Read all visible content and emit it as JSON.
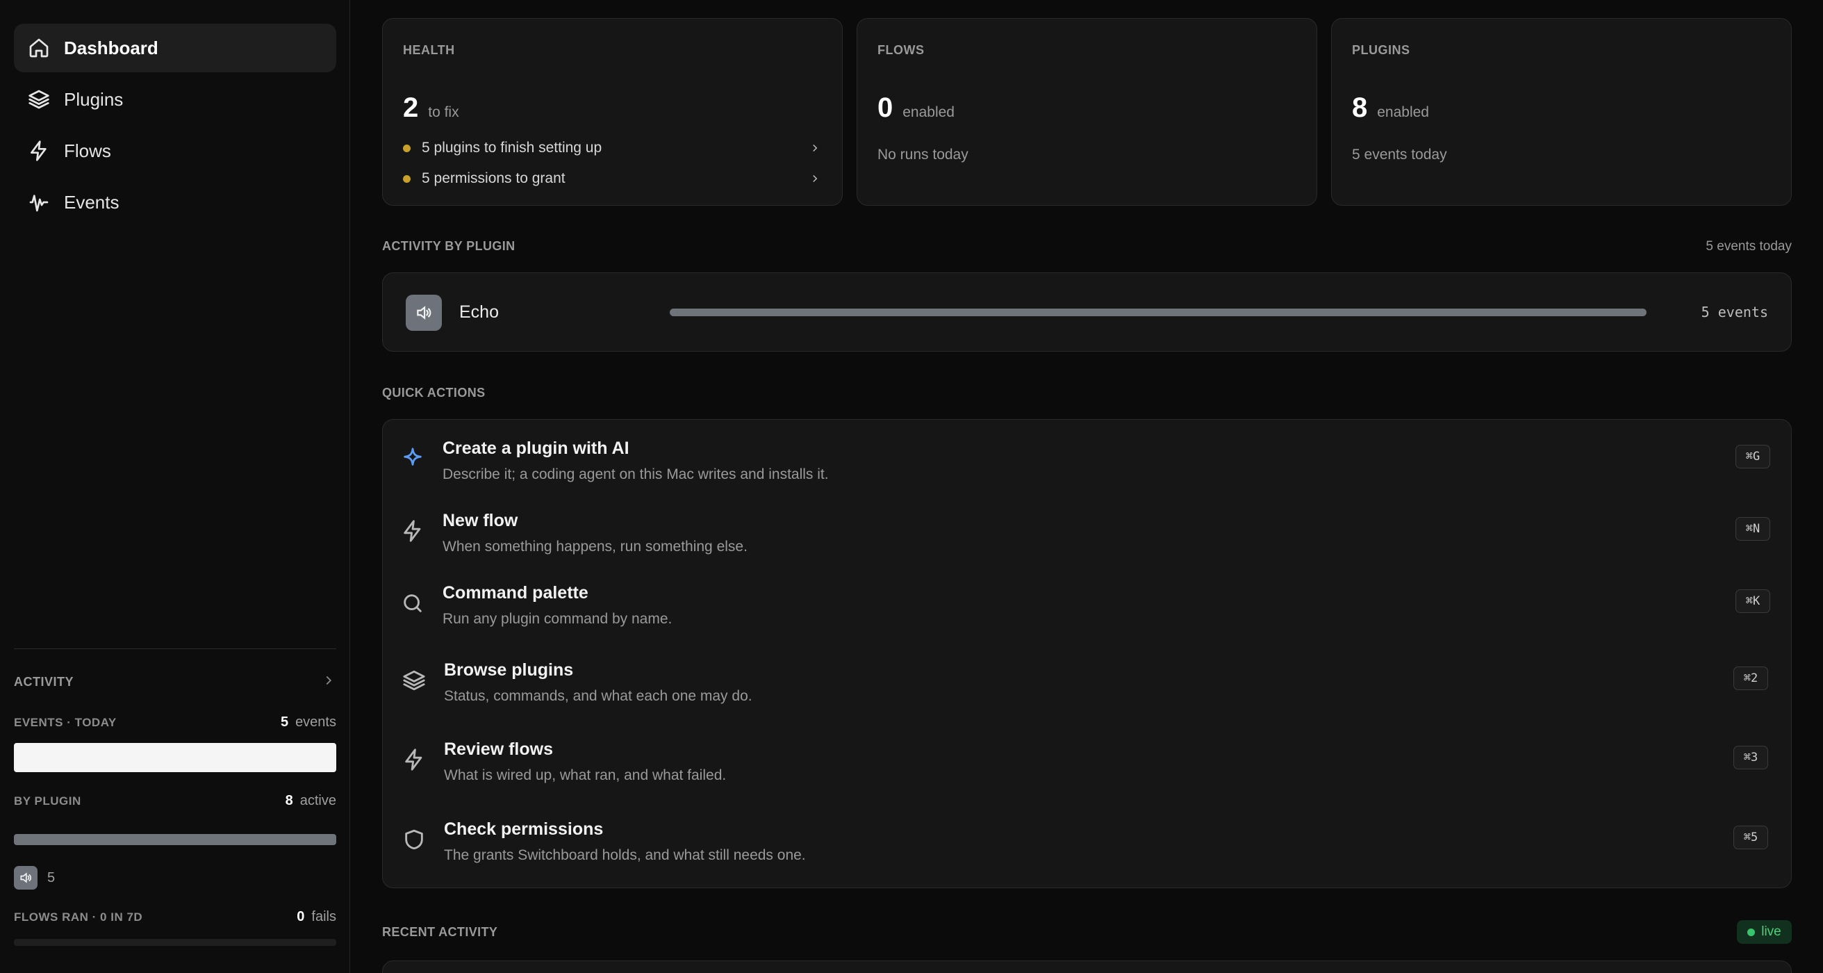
{
  "sidebar": {
    "nav": [
      {
        "label": "Dashboard",
        "icon": "home-icon",
        "active": true
      },
      {
        "label": "Plugins",
        "icon": "layers-icon",
        "active": false
      },
      {
        "label": "Flows",
        "icon": "bolt-icon",
        "active": false
      },
      {
        "label": "Events",
        "icon": "waveform-icon",
        "active": false
      }
    ],
    "activity": {
      "title": "ACTIVITY",
      "events_label": "EVENTS · TODAY",
      "events_count": "5",
      "events_unit": "events",
      "by_plugin_label": "BY PLUGIN",
      "by_plugin_count": "8",
      "by_plugin_unit": "active",
      "plugin_count": "5",
      "flows_label": "FLOWS RAN · 0 IN 7D",
      "flows_count": "0",
      "flows_unit": "fails"
    }
  },
  "cards": {
    "health": {
      "label": "HEALTH",
      "value": "2",
      "unit": "to fix",
      "issues": [
        "5 plugins to finish setting up",
        "5 permissions to grant"
      ]
    },
    "flows": {
      "label": "FLOWS",
      "value": "0",
      "unit": "enabled",
      "sub": "No runs today"
    },
    "plugins": {
      "label": "PLUGINS",
      "value": "8",
      "unit": "enabled",
      "sub": "5 events today"
    }
  },
  "activity_by_plugin": {
    "title": "ACTIVITY BY PLUGIN",
    "summary": "5 events today",
    "rows": [
      {
        "name": "Echo",
        "count": "5 events",
        "fraction": 1.0
      }
    ]
  },
  "quick_actions": {
    "title": "QUICK ACTIONS",
    "items": [
      {
        "title": "Create a plugin with AI",
        "desc": "Describe it; a coding agent on this Mac writes and installs it.",
        "kbd": "⌘G",
        "icon": "sparkle-icon"
      },
      {
        "title": "New flow",
        "desc": "When something happens, run something else.",
        "kbd": "⌘N",
        "icon": "bolt-icon"
      },
      {
        "title": "Command palette",
        "desc": "Run any plugin command by name.",
        "kbd": "⌘K",
        "icon": "search-icon"
      },
      {
        "title": "Browse plugins",
        "desc": "Status, commands, and what each one may do.",
        "kbd": "⌘2",
        "icon": "layers-icon"
      },
      {
        "title": "Review flows",
        "desc": "What is wired up, what ran, and what failed.",
        "kbd": "⌘3",
        "icon": "bolt-icon"
      },
      {
        "title": "Check permissions",
        "desc": "The grants Switchboard holds, and what still needs one.",
        "kbd": "⌘5",
        "icon": "shield-icon"
      }
    ]
  },
  "recent_activity": {
    "title": "RECENT ACTIVITY",
    "live_label": "live"
  },
  "colors": {
    "accent_ai": "#5b9cf5",
    "warning_dot": "#c8a02a",
    "live_green": "#37c46a"
  }
}
